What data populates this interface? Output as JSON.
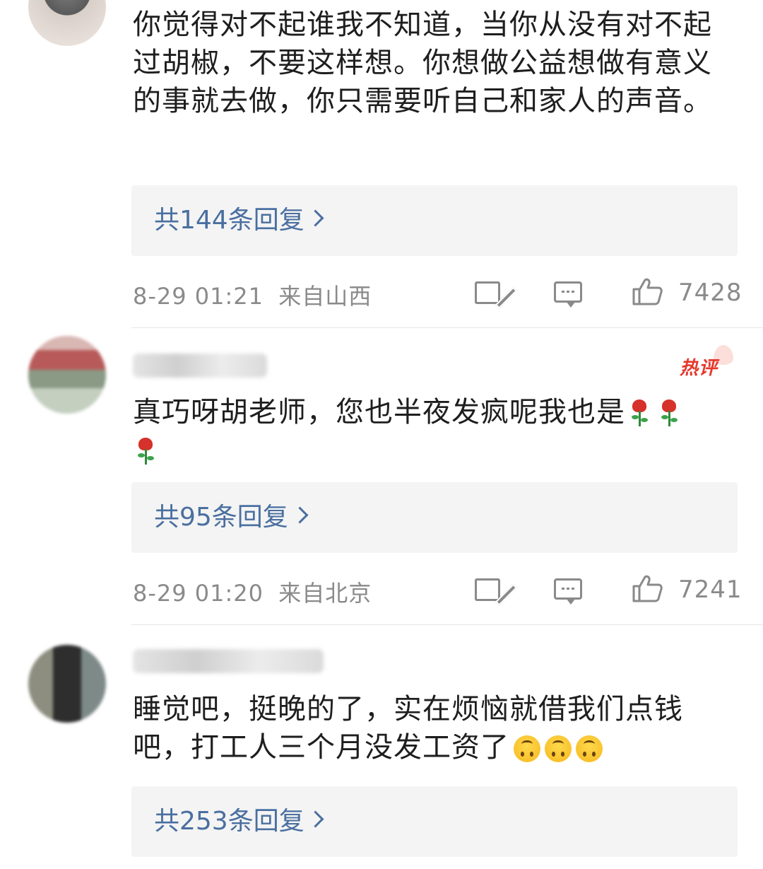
{
  "comments": [
    {
      "text": "你觉得对不起谁我不知道，当你从没有对不起过胡椒，不要这样想。你想做公益想做有意义的事就去做，你只需要听自己和家人的声音。",
      "reply_label": "共144条回复",
      "time": "8-29 01:21",
      "location": "来自山西",
      "likes": "7428"
    },
    {
      "badge": "热评",
      "text": "真巧呀胡老师，您也半夜发疯呢我也是",
      "emoji_icons": [
        "rose-emoji",
        "rose-emoji",
        "rose-emoji"
      ],
      "reply_label": "共95条回复",
      "time": "8-29 01:20",
      "location": "来自北京",
      "likes": "7241"
    },
    {
      "text": "睡觉吧，挺晚的了，实在烦恼就借我们点钱吧，打工人三个月没发工资了",
      "emoji_icons": [
        "upside-down-face-emoji",
        "upside-down-face-emoji",
        "upside-down-face-emoji"
      ],
      "reply_label": "共253条回复"
    }
  ],
  "colors": {
    "reply_link": "#4a6fa0",
    "meta_text": "#8a8a8a",
    "hot_badge": "#e5372c",
    "reply_box_bg": "#f4f4f4"
  },
  "icons": [
    "edit-icon",
    "comment-icon",
    "thumbs-up-icon",
    "chevron-right-icon"
  ]
}
